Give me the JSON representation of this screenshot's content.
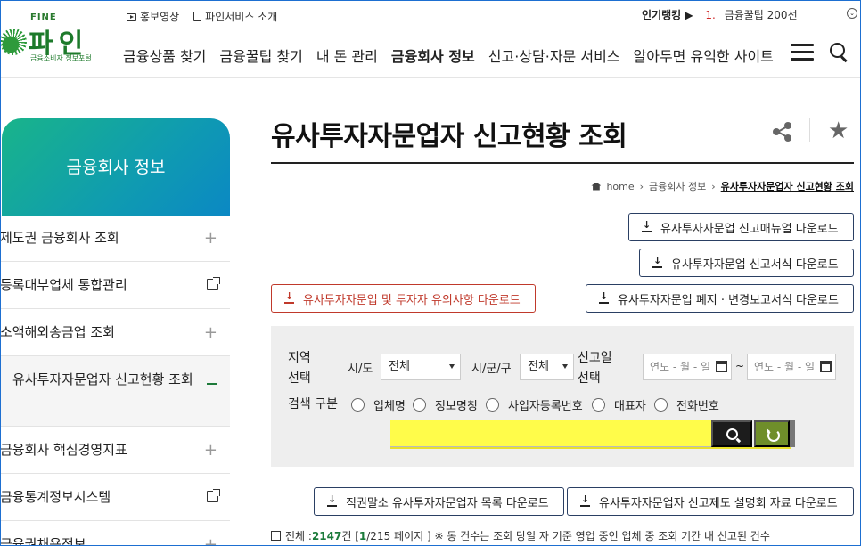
{
  "header": {
    "logo": {
      "top": "FINE",
      "name": "파인",
      "sub": "금융소비자 정보포털"
    },
    "toplinks": [
      "홍보영상",
      "파인서비스 소개"
    ],
    "ranking": {
      "label": "인기랭킹 ▶",
      "num": "1.",
      "item": "금융꿀팁 200선"
    },
    "nav": [
      "금융상품 찾기",
      "금융꿀팁 찾기",
      "내 돈 관리",
      "금융회사 정보",
      "신고·상담·자문 서비스",
      "알아두면 유익한 사이트"
    ]
  },
  "sidebar": {
    "title": "금융회사 정보",
    "items": [
      {
        "label": "제도권 금융회사 조회",
        "icon": "plus"
      },
      {
        "label": "등록대부업체 통합관리",
        "icon": "external-link"
      },
      {
        "label": "소액해외송금업 조회",
        "icon": "plus"
      },
      {
        "label": "유사투자자문업자 신고현황 조회",
        "icon": "minus"
      },
      {
        "label": "금융회사 핵심경영지표",
        "icon": "plus"
      },
      {
        "label": "금융통계정보시스템",
        "icon": "external-link"
      },
      {
        "label": "금융권채용정보",
        "icon": "plus"
      }
    ]
  },
  "main": {
    "title": "유사투자자문업자 신고현황 조회",
    "breadcrumb": [
      "home",
      "금융회사 정보",
      "유사투자자문업자 신고현황 조회"
    ],
    "downloads": {
      "manual": "유사투자자문업 신고매뉴얼 다운로드",
      "form": "유사투자자문업 신고서식 다운로드",
      "caution": "유사투자자문업 및 투자자 유의사항 다운로드",
      "closure": "유사투자자문업 폐지 · 변경보고서식 다운로드",
      "delisted": "직권말소 유사투자자문업자 목록 다운로드",
      "briefing": "유사투자자문업자 신고제도 설명회 자료 다운로드"
    },
    "search": {
      "region_label_1": "지역",
      "region_label_2": "선택",
      "sido_label": "시/도",
      "sido_value": "전체",
      "sigungu_label": "시/군/구",
      "sigungu_value": "전체",
      "date_label_1": "신고일",
      "date_label_2": "선택",
      "date_placeholder": "연도 - 월 - 일",
      "date_sep": "~",
      "type_label": "검색 구분",
      "types": [
        "업체명",
        "정보명칭",
        "사업자등록번호",
        "대표자",
        "전화번호"
      ],
      "keyword": ""
    },
    "summary": {
      "prefix": "전체 :",
      "total": "2147",
      "unit": "건 [",
      "page": "1",
      "pages": "/215 페이지 ]",
      "note": "※ 동 건수는 조회 당일 자 기준 영업 중인 업체 중 조회 기간 내 신고된 건수"
    }
  }
}
